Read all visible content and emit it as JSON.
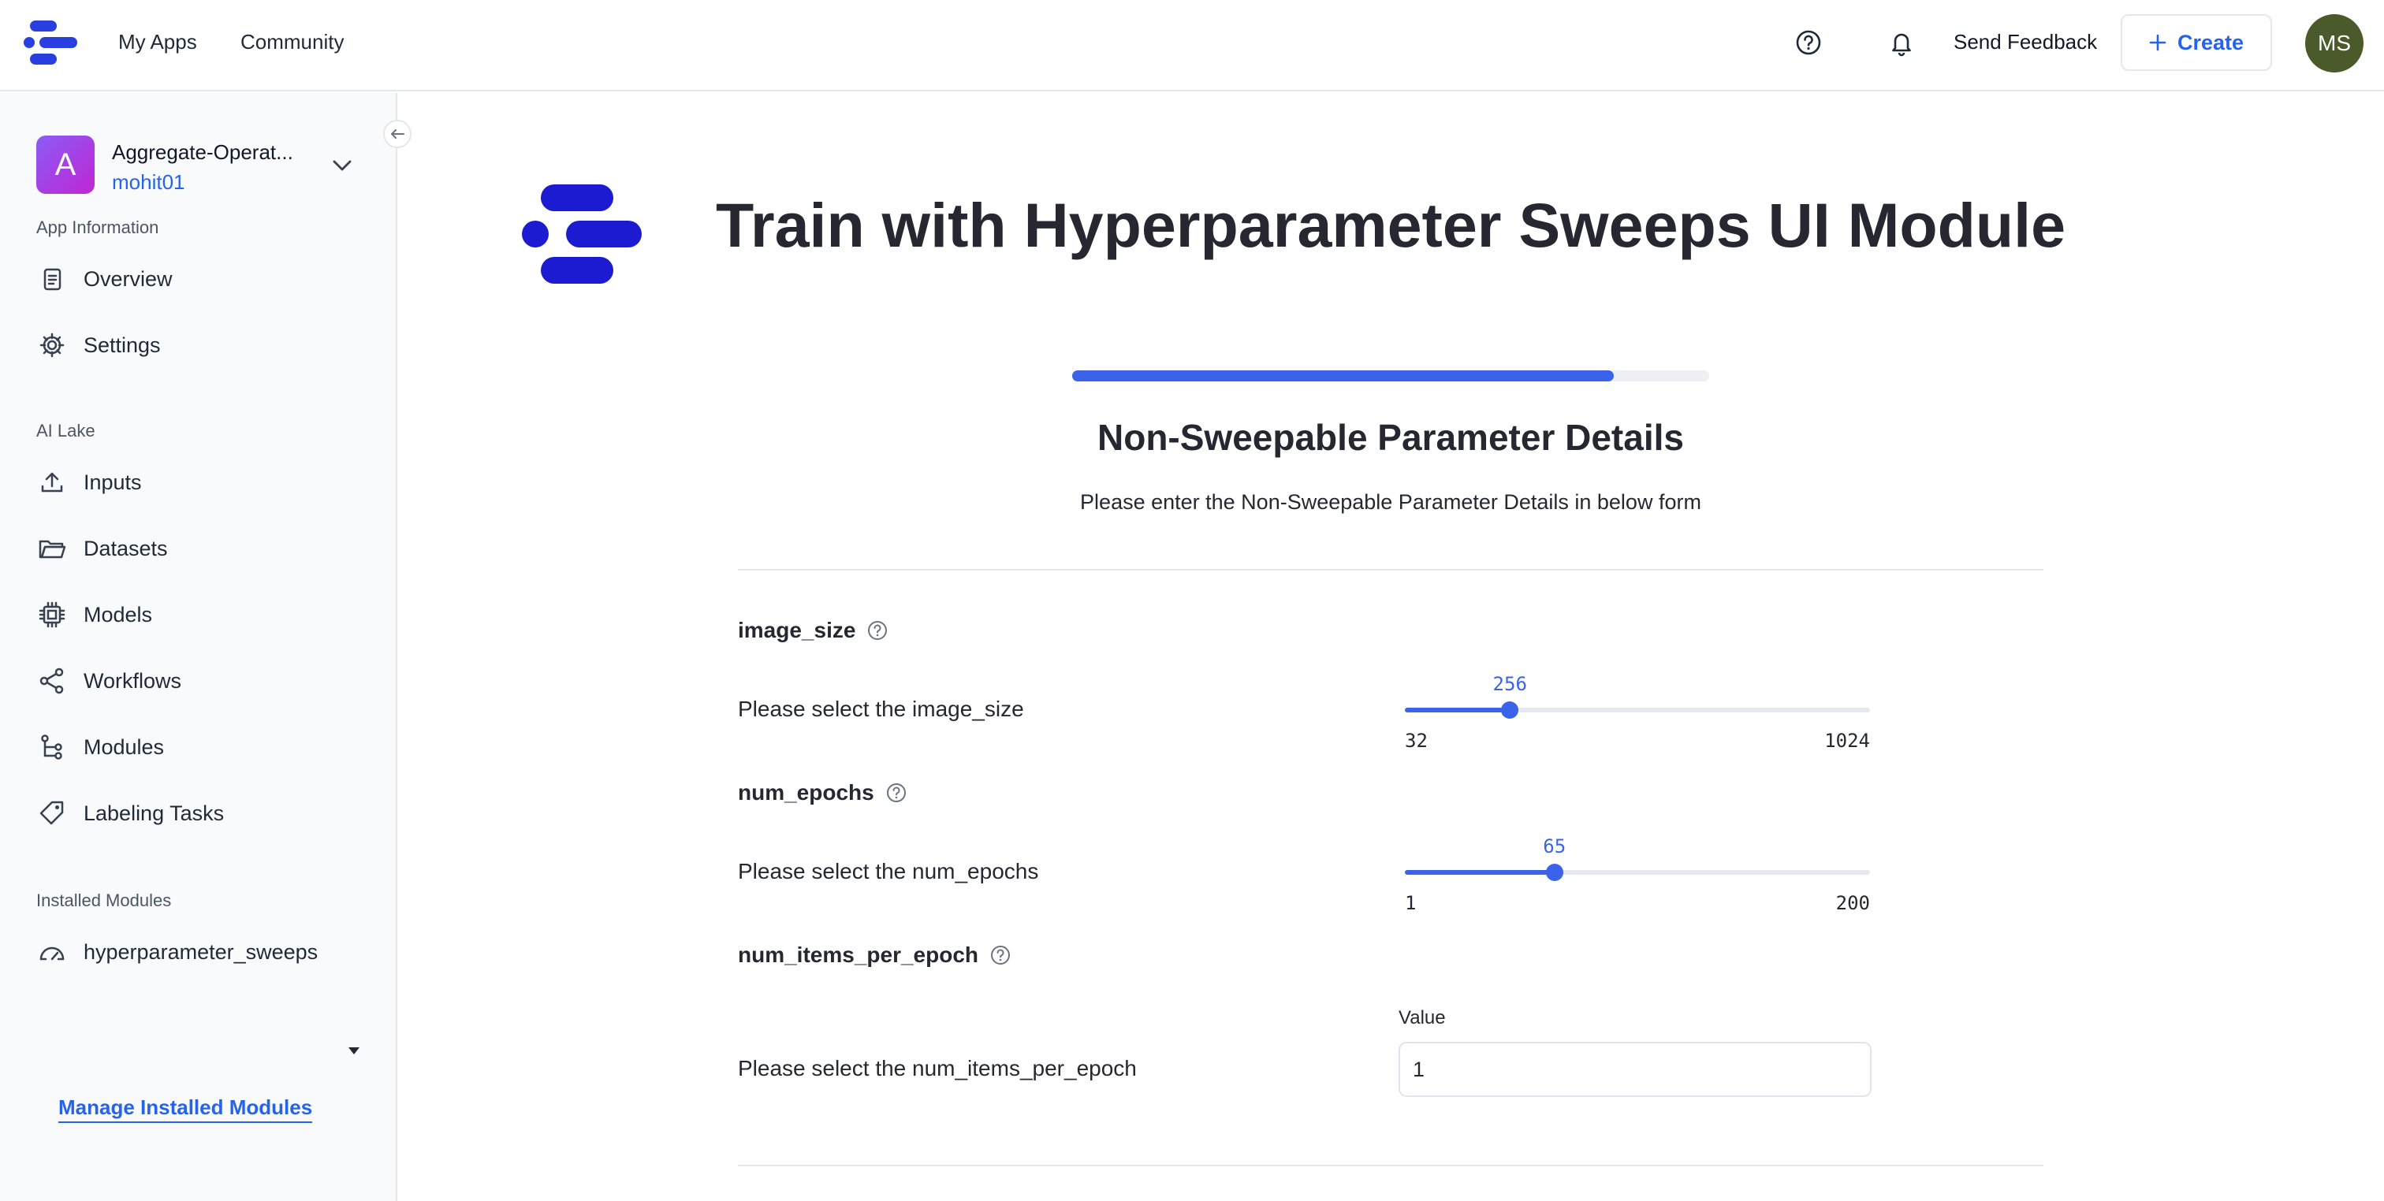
{
  "topbar": {
    "nav": [
      {
        "label": "My Apps"
      },
      {
        "label": "Community"
      }
    ],
    "send_feedback": "Send Feedback",
    "create_label": "Create",
    "avatar_initials": "MS",
    "icons": [
      "clarifai-logo-icon",
      "help-circle-icon",
      "bell-icon",
      "plus-icon"
    ]
  },
  "sidebar": {
    "app": {
      "initial": "A",
      "name": "Aggregate-Operat...",
      "user": "mohit01"
    },
    "app_information_label": "App Information",
    "app_information_items": [
      {
        "label": "Overview",
        "icon": "document-icon"
      },
      {
        "label": "Settings",
        "icon": "gear-icon"
      }
    ],
    "ai_lake_label": "AI Lake",
    "ai_lake_items": [
      {
        "label": "Inputs",
        "icon": "upload-icon"
      },
      {
        "label": "Datasets",
        "icon": "folder-icon"
      },
      {
        "label": "Models",
        "icon": "chip-icon"
      },
      {
        "label": "Workflows",
        "icon": "share-icon"
      },
      {
        "label": "Modules",
        "icon": "modules-icon"
      },
      {
        "label": "Labeling Tasks",
        "icon": "tag-icon"
      }
    ],
    "installed_modules_label": "Installed Modules",
    "installed_modules": [
      {
        "label": "hyperparameter_sweeps",
        "icon": "gauge-icon"
      }
    ],
    "manage_link": "Manage Installed Modules"
  },
  "main": {
    "title": "Train with Hyperparameter Sweeps UI Module",
    "progress": 0.85,
    "section_title": "Non-Sweepable Parameter Details",
    "section_subtitle": "Please enter the Non-Sweepable Parameter Details in below form",
    "params": [
      {
        "name": "image_size",
        "description": "Please select the image_size",
        "type": "slider",
        "min": 32,
        "max": 1024,
        "value": 256
      },
      {
        "name": "num_epochs",
        "description": "Please select the num_epochs",
        "type": "slider",
        "min": 1,
        "max": 200,
        "value": 65
      },
      {
        "name": "num_items_per_epoch",
        "description": "Please select the num_items_per_epoch",
        "type": "number",
        "input_label": "Value",
        "value": "1"
      }
    ]
  },
  "colors": {
    "accent": "#3b63ea",
    "link": "#2563eb",
    "logo": "#1d1bd1",
    "avatar_bg": "#4b5a2b",
    "app_avatar": "#a855f7"
  }
}
